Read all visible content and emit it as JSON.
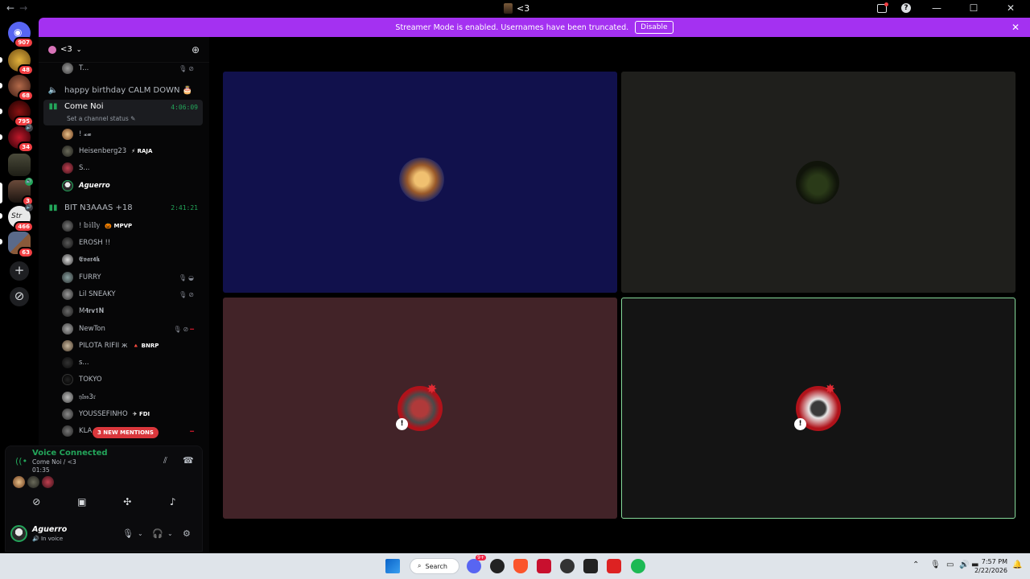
{
  "titlebar": {
    "back": "←",
    "forward": "→",
    "title": "<3",
    "minimize": "—",
    "maximize": "☐",
    "close": "✕"
  },
  "banner": {
    "text": "Streamer Mode is enabled. Usernames have been truncated.",
    "disable_label": "Disable",
    "close": "✕"
  },
  "rail": {
    "servers": [
      {
        "badge": "907"
      },
      {
        "badge": "48"
      },
      {
        "badge": "68"
      },
      {
        "badge": "795"
      },
      {
        "badge": "34"
      },
      {
        "badge": ""
      },
      {
        "badge": "3"
      },
      {
        "badge": "466"
      },
      {
        "badge": "63"
      }
    ],
    "add_label": "+",
    "explore_label": "⊘"
  },
  "guild": {
    "name": "<3"
  },
  "channels": {
    "prev_user": "T...",
    "birthday": "happy birthday CALM DOWN 🎂",
    "come_noi": {
      "name": "Come Noi",
      "time": "4:06:09",
      "status": "Set a channel status ✎"
    },
    "come_noi_users": [
      {
        "name": "! 𝔁𝓪",
        "tag": ""
      },
      {
        "name": "Heisenberg23",
        "tag": "⚡ RAJA"
      },
      {
        "name": "S...",
        "tag": ""
      },
      {
        "name": "Aguerro",
        "tag": ""
      }
    ],
    "bit": {
      "name": "BIT N3AAAS +18",
      "time": "2:41:21"
    },
    "bit_users": [
      {
        "name": "! 𝕓𝕚𝕝𝕝𝕪",
        "tag": "🎃 MPVP"
      },
      {
        "name": "EROSH !!",
        "tag": ""
      },
      {
        "name": "𝕰𝖛𝖆𝖗𝟰𝖐",
        "tag": ""
      },
      {
        "name": "FURRY",
        "tag": ""
      },
      {
        "name": "Lil SNEAKY",
        "tag": ""
      },
      {
        "name": "M𝟒𝐫𝐯𝟏𝐍",
        "tag": ""
      },
      {
        "name": "NewTon",
        "tag": ""
      },
      {
        "name": "PILOTA RIFII ж",
        "tag": "🔺 BNRP"
      },
      {
        "name": "s...",
        "tag": ""
      },
      {
        "name": "TOKYO",
        "tag": ""
      },
      {
        "name": "𝔶𝔩𝔰𝔰3𝔯",
        "tag": ""
      },
      {
        "name": "YOUSSEFINHO",
        "tag": "✈ FDI"
      },
      {
        "name": "KLA",
        "tag": ""
      }
    ],
    "mentions_label": "3 NEW MENTIONS"
  },
  "voice": {
    "title": "Voice Connected",
    "channel": "Come Noi / <3",
    "timer": "01:35"
  },
  "me": {
    "name": "Aguerro",
    "status": "🔊 In voice"
  },
  "taskbar": {
    "search_label": "Search",
    "time": "7:57 PM",
    "date": "2/22/2026",
    "discord_badge": "9+"
  },
  "colors": {
    "accent_purple": "#a431f1",
    "voice_green": "#23a55a",
    "tile1": "#11114c",
    "tile2": "#1f1f1c",
    "tile3": "#422328",
    "tile4": "#141414",
    "speaking_border": "#85d99a"
  }
}
